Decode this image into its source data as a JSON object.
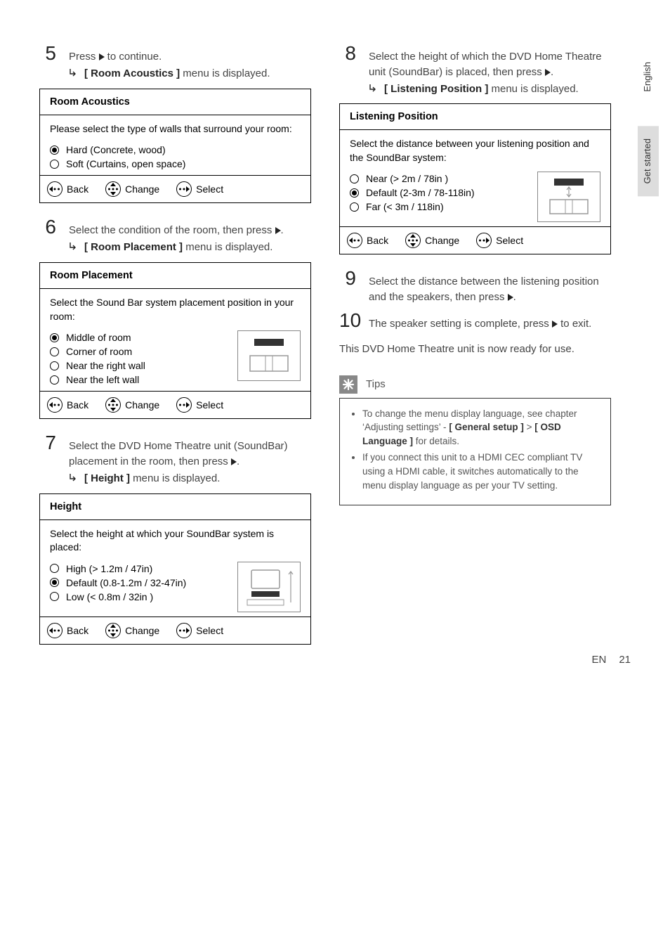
{
  "tabs": {
    "lang": "English",
    "section": "Get started"
  },
  "footer": {
    "lang": "EN",
    "page": "21"
  },
  "left": {
    "step5": {
      "num": "5",
      "text_a": "Press ",
      "text_b": " to continue.",
      "result_a": "[ Room Acoustics ]",
      "result_b": " menu is displayed."
    },
    "osd1": {
      "title": "Room Acoustics",
      "prompt": "Please select the type of walls that surround your room:",
      "opts": [
        "Hard (Concrete, wood)",
        "Soft (Curtains, open space)"
      ],
      "selected": 0,
      "back": "Back",
      "change": "Change",
      "select": "Select"
    },
    "step6": {
      "num": "6",
      "text_a": "Select the condition of the room, then press ",
      "text_b": ".",
      "result_a": "[ Room Placement ]",
      "result_b": " menu is displayed."
    },
    "osd2": {
      "title": "Room Placement",
      "prompt": "Select the Sound Bar system placement position in your room:",
      "opts": [
        "Middle of room",
        "Corner of room",
        "Near the right wall",
        "Near the left wall"
      ],
      "selected": 0,
      "back": "Back",
      "change": "Change",
      "select": "Select"
    },
    "step7": {
      "num": "7",
      "text_a": "Select the DVD Home Theatre unit (SoundBar) placement in the room, then press ",
      "text_b": ".",
      "result_a": "[ Height ]",
      "result_b": " menu is displayed."
    },
    "osd3": {
      "title": "Height",
      "prompt": "Select the height at which your SoundBar system is placed:",
      "opts": [
        "High (> 1.2m / 47in)",
        "Default (0.8-1.2m / 32-47in)",
        "Low (< 0.8m / 32in )"
      ],
      "selected": 1,
      "back": "Back",
      "change": "Change",
      "select": "Select"
    }
  },
  "right": {
    "step8": {
      "num": "8",
      "text_a": "Select the height of which the DVD Home Theatre unit (SoundBar) is placed, then press ",
      "text_b": ".",
      "result_a": "[ Listening Position ]",
      "result_b": " menu is displayed."
    },
    "osd4": {
      "title": "Listening Position",
      "prompt": "Select the distance between your listening position and the SoundBar system:",
      "opts": [
        "Near (> 2m / 78in )",
        "Default (2-3m / 78-118in)",
        "Far (< 3m / 118in)"
      ],
      "selected": 1,
      "back": "Back",
      "change": "Change",
      "select": "Select"
    },
    "step9": {
      "num": "9",
      "text_a": "Select the distance between the listening position and the speakers, then press ",
      "text_b": "."
    },
    "step10": {
      "num": "10",
      "text_a": "The speaker setting is complete, press ",
      "text_b": " to exit."
    },
    "closing": "This DVD Home Theatre unit is now ready for use.",
    "tips": {
      "title": "Tips",
      "item1_a": "To change the menu display language, see chapter ‘Adjusting settings’ - ",
      "item1_b": "[ General setup ]",
      "item1_c": " > ",
      "item1_d": "[ OSD Language ]",
      "item1_e": " for details.",
      "item2": "If you connect this unit to a HDMI CEC compliant TV using a HDMI cable, it switches automatically to the menu display language as per your TV setting."
    }
  }
}
